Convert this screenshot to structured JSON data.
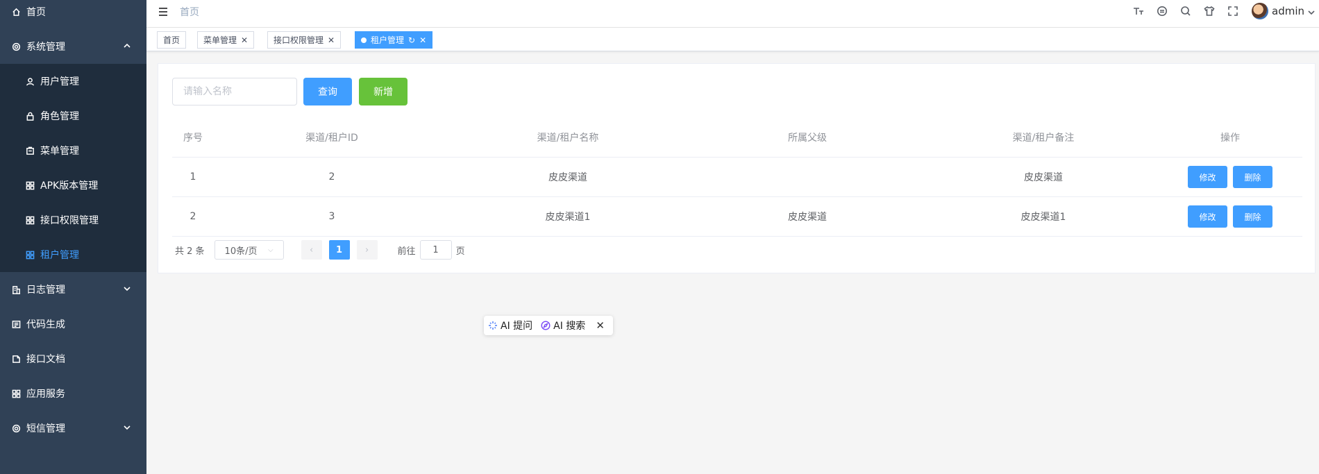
{
  "sidebar": {
    "items": [
      {
        "label": "首页",
        "icon": "home-icon"
      },
      {
        "label": "系统管理",
        "icon": "gear-icon"
      },
      {
        "label": "用户管理",
        "icon": "user-icon"
      },
      {
        "label": "角色管理",
        "icon": "lock-icon"
      },
      {
        "label": "菜单管理",
        "icon": "menu-icon"
      },
      {
        "label": "APK版本管理",
        "icon": "grid-icon"
      },
      {
        "label": "接口权限管理",
        "icon": "grid-icon"
      },
      {
        "label": "租户管理",
        "icon": "grid-icon"
      },
      {
        "label": "日志管理",
        "icon": "log-icon"
      },
      {
        "label": "代码生成",
        "icon": "code-icon"
      },
      {
        "label": "接口文档",
        "icon": "doc-icon"
      },
      {
        "label": "应用服务",
        "icon": "grid-icon"
      },
      {
        "label": "短信管理",
        "icon": "gear-icon"
      }
    ],
    "active_color": "#409eff",
    "bg_color": "#304156"
  },
  "header": {
    "breadcrumb": "首页",
    "user_name": "admin"
  },
  "tags": [
    {
      "label": "首页"
    },
    {
      "label": "菜单管理"
    },
    {
      "label": "接口权限管理"
    },
    {
      "label": "租户管理"
    }
  ],
  "search": {
    "placeholder": "请输入名称",
    "query_label": "查询",
    "add_label": "新增"
  },
  "table": {
    "columns": [
      "序号",
      "渠道/租户ID",
      "渠道/租户名称",
      "所属父级",
      "渠道/租户备注",
      "操作"
    ],
    "rows": [
      {
        "index": "1",
        "id": "2",
        "name": "皮皮渠道",
        "parent": "",
        "remark": "皮皮渠道"
      },
      {
        "index": "2",
        "id": "3",
        "name": "皮皮渠道1",
        "parent": "皮皮渠道",
        "remark": "皮皮渠道1"
      }
    ],
    "edit_label": "修改",
    "delete_label": "删除"
  },
  "pagination": {
    "total": "共 2 条",
    "page_size": "10条/页",
    "current_page": "1",
    "goto_prefix": "前往",
    "goto_value": "1",
    "goto_suffix": "页"
  },
  "ai_toolbar": {
    "ask_label": "AI 提问",
    "search_label": "AI 搜索"
  }
}
